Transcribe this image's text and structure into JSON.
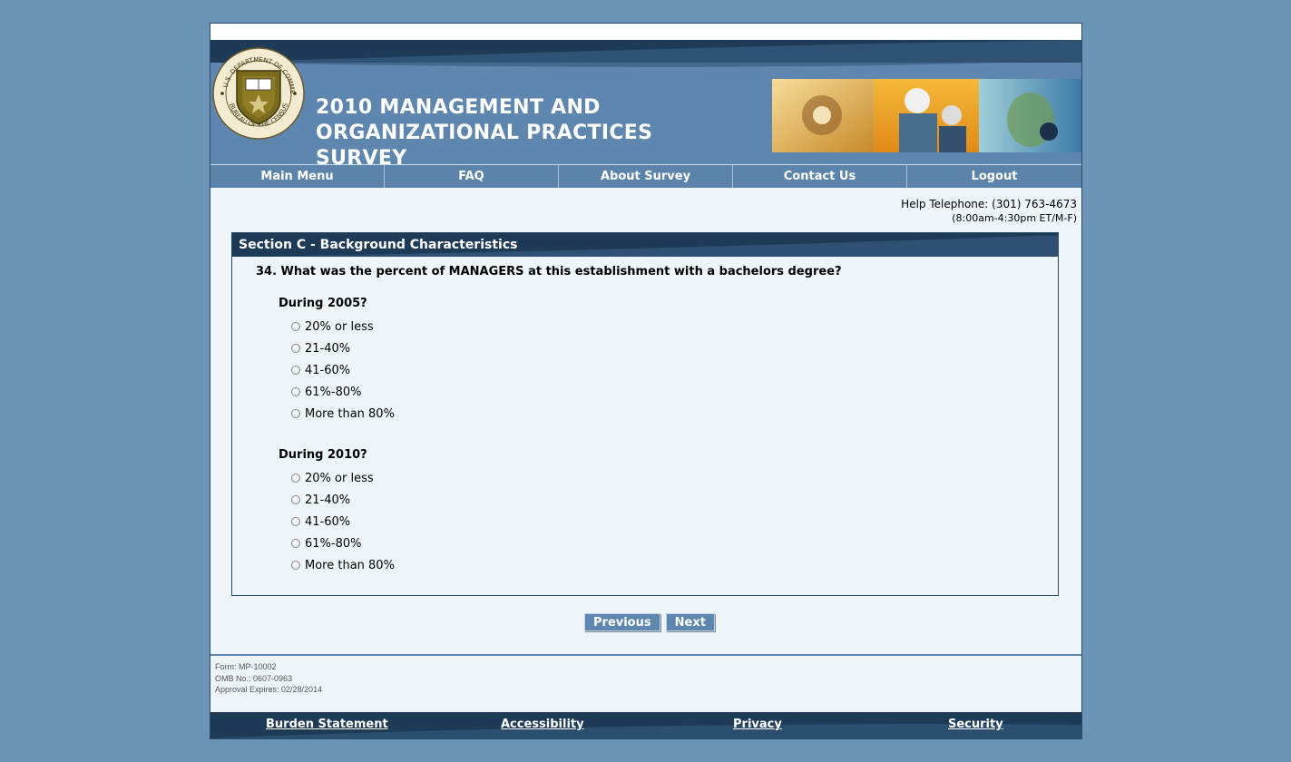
{
  "header": {
    "title": "2010 MANAGEMENT AND ORGANIZATIONAL PRACTICES SURVEY",
    "seal_text": "U.S. DEPARTMENT OF COMMERCE · BUREAU OF THE CENSUS"
  },
  "nav": {
    "items": [
      {
        "label": "Main Menu"
      },
      {
        "label": "FAQ"
      },
      {
        "label": "About Survey"
      },
      {
        "label": "Contact Us"
      },
      {
        "label": "Logout"
      }
    ]
  },
  "help": {
    "telephone": "Help Telephone: (301) 763-4673",
    "hours": "(8:00am-4:30pm ET/M-F)"
  },
  "section": {
    "title": "Section C - Background Characteristics",
    "question": "34. What was the percent of MANAGERS at this establishment with a bachelors degree?",
    "groups": [
      {
        "label": "During 2005?",
        "options": [
          "20% or less",
          "21-40%",
          "41-60%",
          "61%-80%",
          "More than 80%"
        ]
      },
      {
        "label": "During 2010?",
        "options": [
          "20% or less",
          "21-40%",
          "41-60%",
          "61%-80%",
          "More than 80%"
        ]
      }
    ]
  },
  "buttons": {
    "previous": "Previous",
    "next": "Next"
  },
  "form_info": {
    "form": "Form: MP-10002",
    "omb": "OMB No.: 0607-0963",
    "expires": "Approval Expires: 02/28/2014"
  },
  "footer": {
    "links": [
      {
        "label": "Burden Statement"
      },
      {
        "label": "Accessibility"
      },
      {
        "label": "Privacy"
      },
      {
        "label": "Security"
      }
    ]
  },
  "colors": {
    "page_bg": "#6a93b5",
    "dark_navy": "#1d3a57",
    "header_blue": "#5f86ae",
    "content_bg": "#eef6fc"
  }
}
